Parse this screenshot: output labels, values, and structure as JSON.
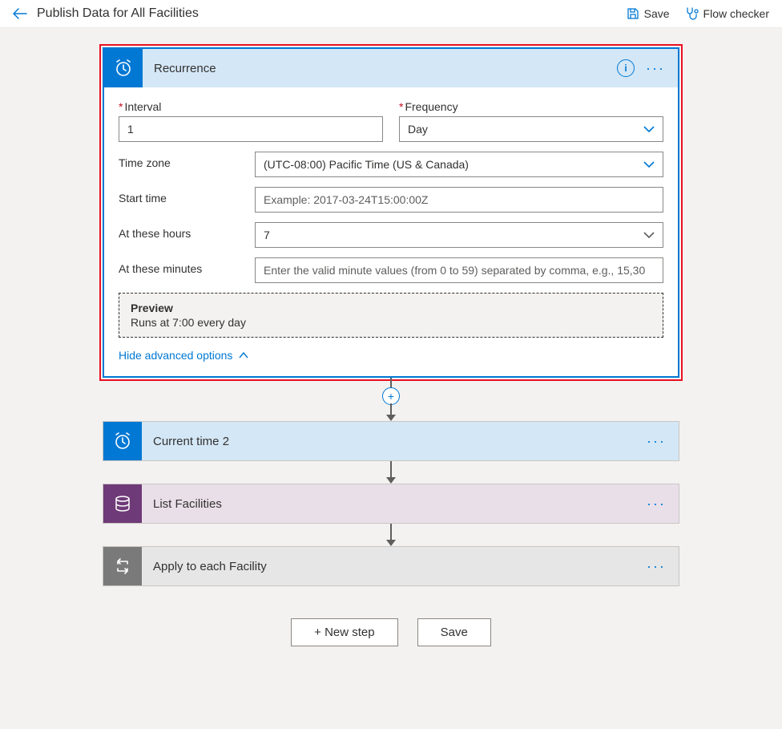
{
  "topbar": {
    "title": "Publish Data for All Facilities",
    "save_label": "Save",
    "flowchecker_label": "Flow checker"
  },
  "recurrence": {
    "title": "Recurrence",
    "interval_label": "Interval",
    "interval_value": "1",
    "frequency_label": "Frequency",
    "frequency_value": "Day",
    "timezone_label": "Time zone",
    "timezone_value": "(UTC-08:00) Pacific Time (US & Canada)",
    "starttime_label": "Start time",
    "starttime_placeholder": "Example: 2017-03-24T15:00:00Z",
    "hours_label": "At these hours",
    "hours_value": "7",
    "minutes_label": "At these minutes",
    "minutes_placeholder": "Enter the valid minute values (from 0 to 59) separated by comma, e.g., 15,30",
    "preview_title": "Preview",
    "preview_text": "Runs at 7:00 every day",
    "hide_advanced": "Hide advanced options"
  },
  "steps": {
    "current_time": "Current time 2",
    "list_facilities": "List Facilities",
    "apply_each": "Apply to each Facility"
  },
  "bottom": {
    "new_step": "+ New step",
    "save": "Save"
  }
}
